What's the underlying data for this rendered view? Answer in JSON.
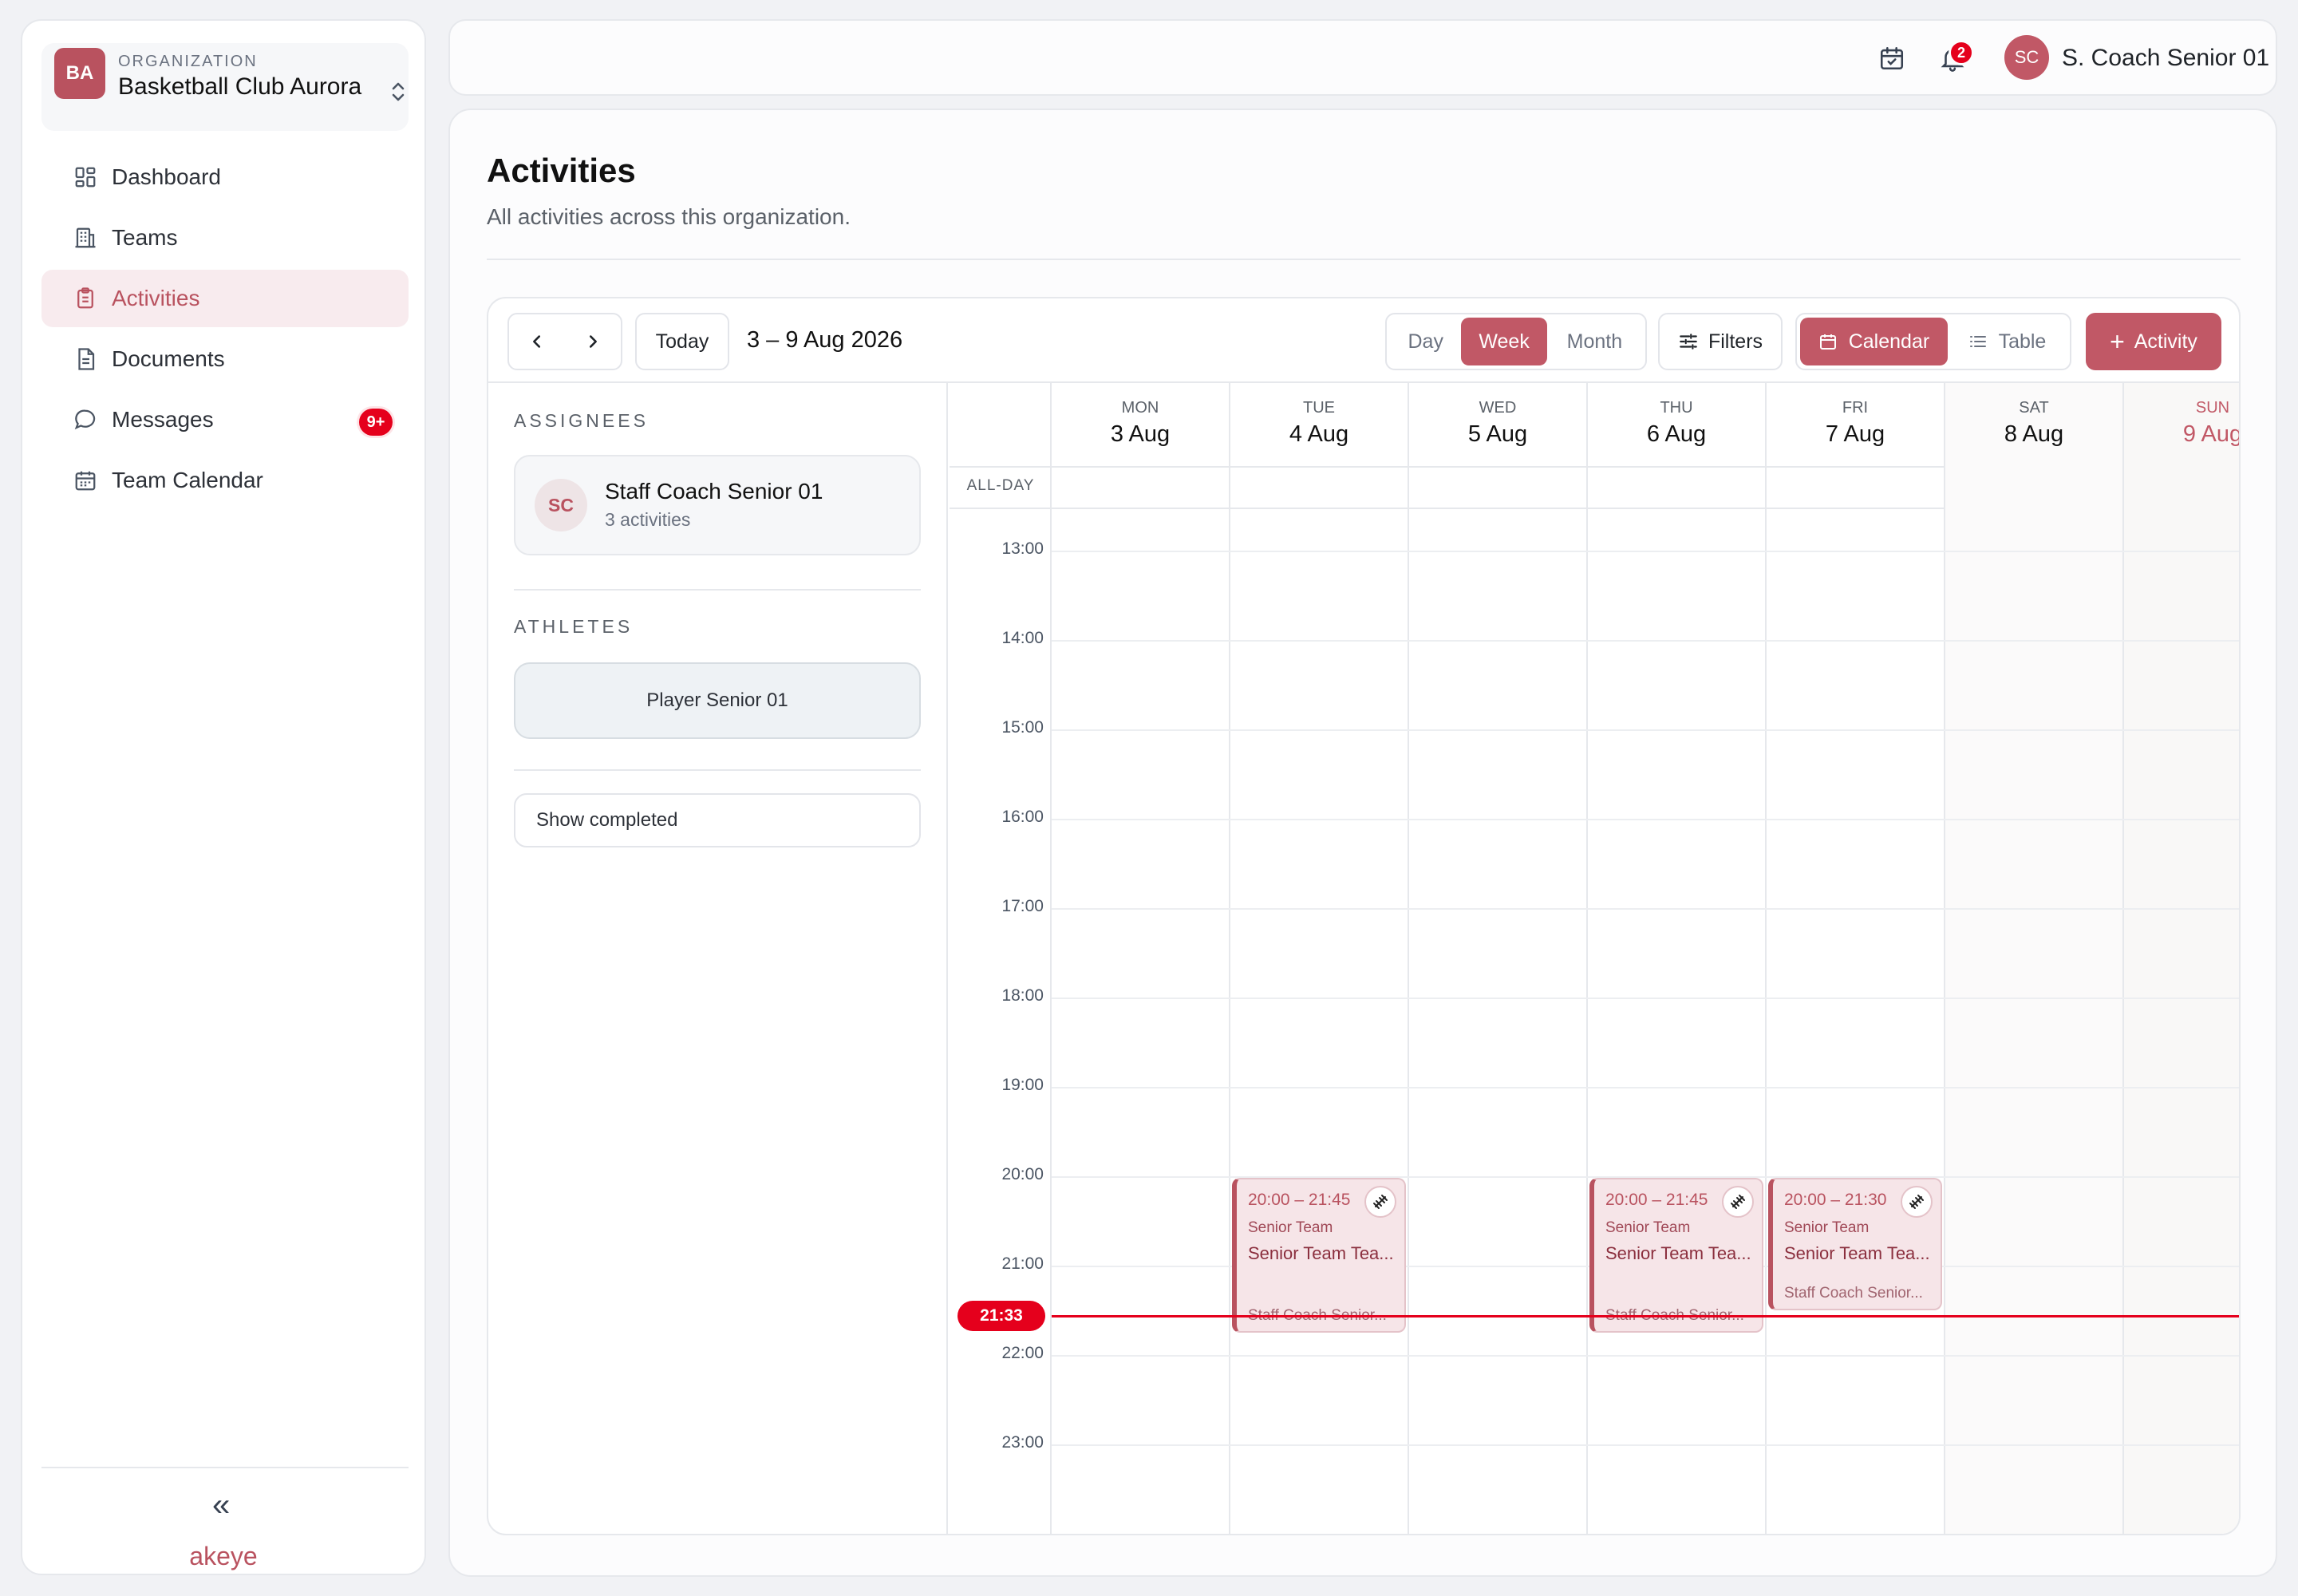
{
  "org": {
    "initials": "BA",
    "caption": "ORGANIZATION",
    "name": "Basketball Club Aurora"
  },
  "nav": [
    {
      "label": "Dashboard",
      "icon": "dashboard-icon",
      "active": false
    },
    {
      "label": "Teams",
      "icon": "building-icon",
      "active": false
    },
    {
      "label": "Activities",
      "icon": "clipboard-icon",
      "active": true
    },
    {
      "label": "Documents",
      "icon": "document-icon",
      "active": false
    },
    {
      "label": "Messages",
      "icon": "chat-bubble-icon",
      "active": false,
      "badge": "9+"
    },
    {
      "label": "Team Calendar",
      "icon": "calendar-icon",
      "active": false
    }
  ],
  "sidebar_footer": {
    "collapse": "«",
    "brand": "akeye"
  },
  "topbar": {
    "notifications": "2",
    "user_initials": "SC",
    "user_name": "S. Coach Senior 01"
  },
  "page": {
    "title": "Activities",
    "subtitle": "All activities across this organization."
  },
  "toolbar": {
    "today": "Today",
    "range": "3 – 9 Aug 2026",
    "views": [
      "Day",
      "Week",
      "Month"
    ],
    "active_view": "Week",
    "filters": "Filters",
    "modes": [
      "Calendar",
      "Table"
    ],
    "active_mode": "Calendar",
    "add": "Activity"
  },
  "filters": {
    "assignees_label": "ASSIGNEES",
    "assignee": {
      "initials": "SC",
      "name": "Staff Coach Senior 01",
      "count": "3 activities"
    },
    "athletes_label": "ATHLETES",
    "athlete": "Player Senior 01",
    "show_completed": "Show completed"
  },
  "calendar": {
    "allday_label": "ALL-DAY",
    "days": [
      {
        "name": "MON",
        "date": "3 Aug"
      },
      {
        "name": "TUE",
        "date": "4 Aug"
      },
      {
        "name": "WED",
        "date": "5 Aug"
      },
      {
        "name": "THU",
        "date": "6 Aug"
      },
      {
        "name": "FRI",
        "date": "7 Aug"
      },
      {
        "name": "SAT",
        "date": "8 Aug"
      },
      {
        "name": "SUN",
        "date": "9 Aug"
      }
    ],
    "today_index": 6,
    "hours": [
      "13:00",
      "14:00",
      "15:00",
      "16:00",
      "17:00",
      "18:00",
      "19:00",
      "20:00",
      "21:00",
      "22:00",
      "23:00"
    ],
    "now": "21:33",
    "events": [
      {
        "day": 1,
        "time": "20:00 – 21:45",
        "team": "Senior Team",
        "title": "Senior Team Tea...",
        "assignee": "Staff Coach Senior...",
        "icon": "dumbbell-icon"
      },
      {
        "day": 3,
        "time": "20:00 – 21:45",
        "team": "Senior Team",
        "title": "Senior Team Tea...",
        "assignee": "Staff Coach Senior...",
        "icon": "dumbbell-icon"
      },
      {
        "day": 4,
        "time": "20:00 – 21:30",
        "team": "Senior Team",
        "title": "Senior Team Tea...",
        "assignee": "Staff Coach Senior...",
        "icon": "dumbbell-icon"
      }
    ]
  },
  "colors": {
    "accent": "#c15866",
    "accent_dark": "#b9525f",
    "now_red": "#e5001c",
    "event_bg": "#f6e5e8"
  }
}
